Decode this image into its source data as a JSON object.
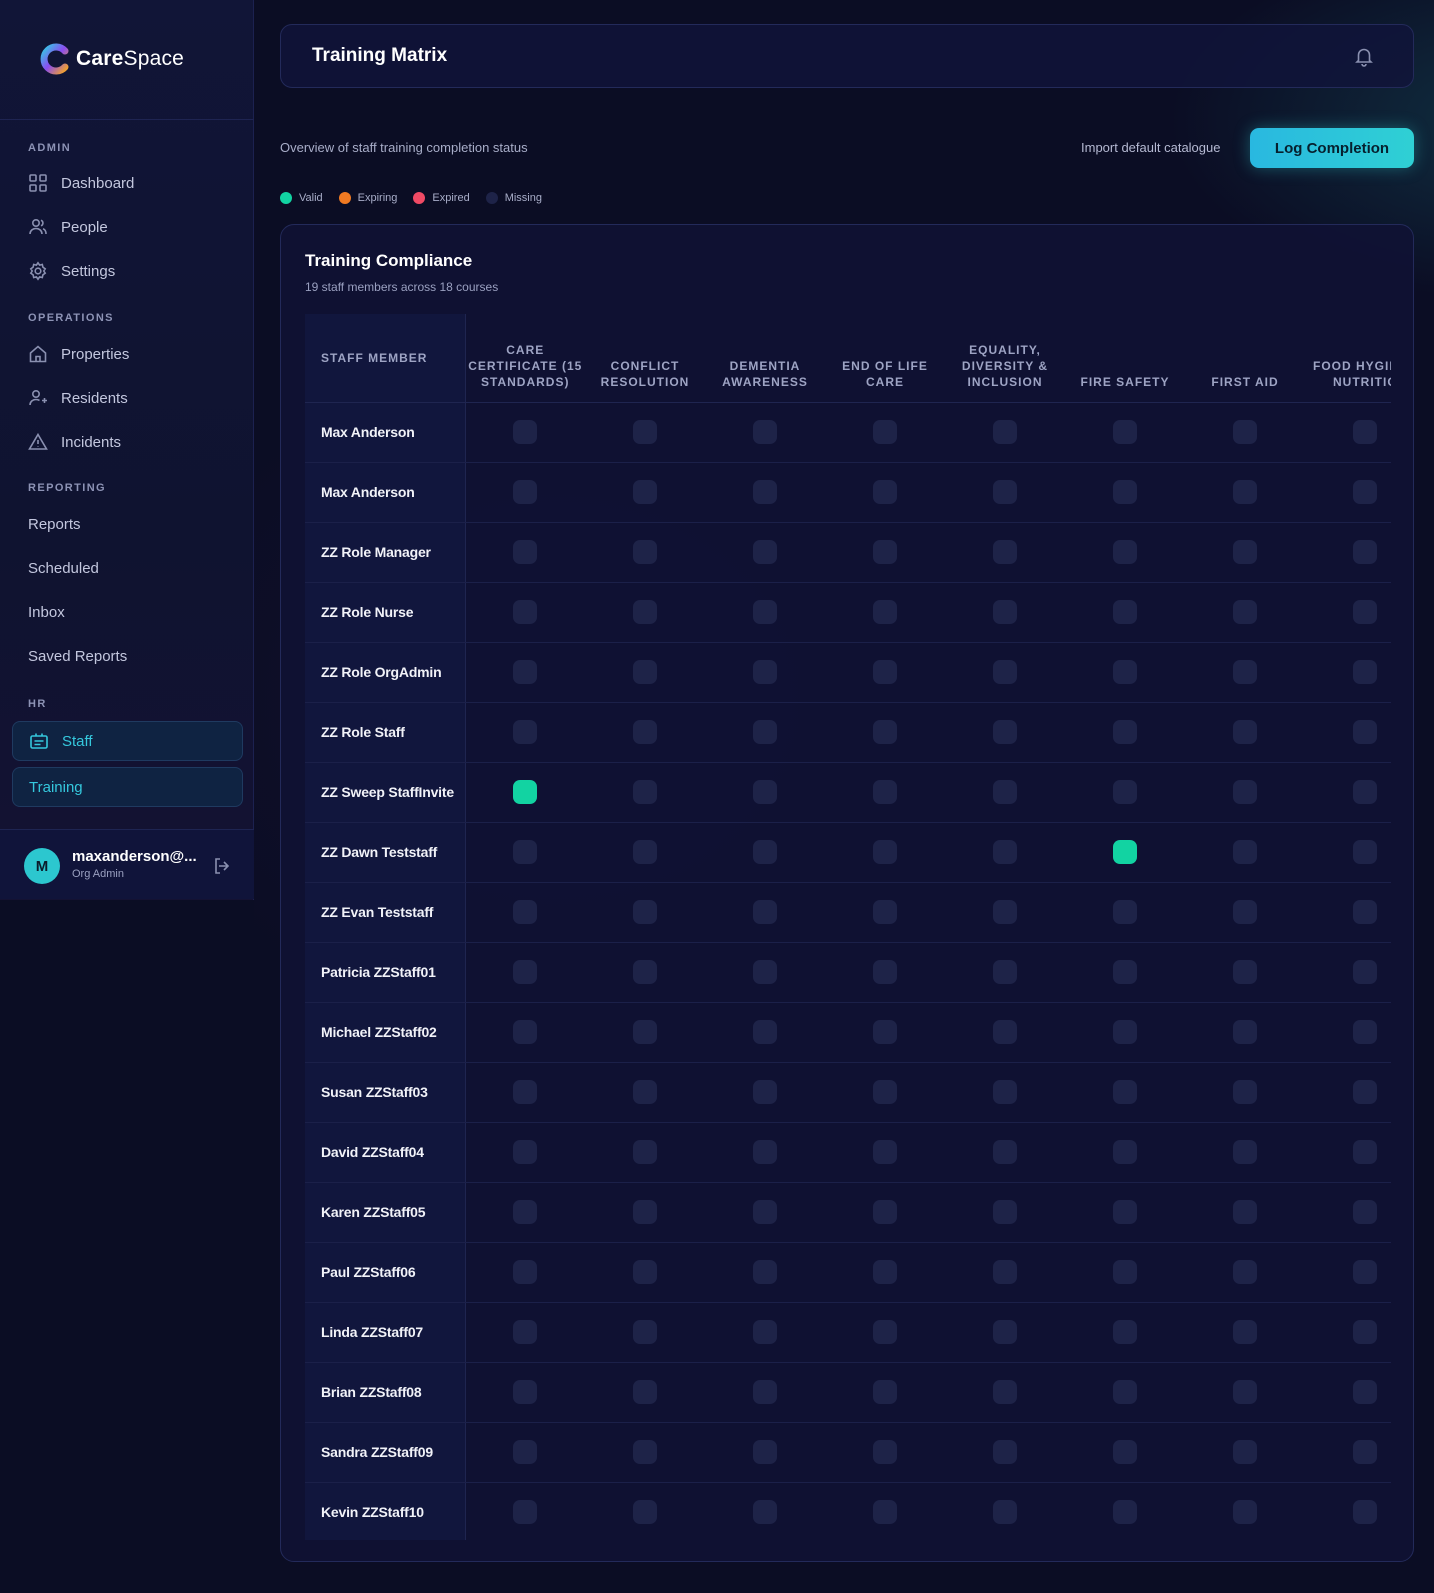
{
  "app": {
    "name_bold": "Care",
    "name_rest": "Space"
  },
  "sidebar": {
    "sections": {
      "admin": "ADMIN",
      "operations": "OPERATIONS",
      "reporting": "REPORTING",
      "hr": "HR"
    },
    "items": {
      "dashboard": "Dashboard",
      "people": "People",
      "settings": "Settings",
      "properties": "Properties",
      "residents": "Residents",
      "incidents": "Incidents",
      "reports": "Reports",
      "scheduled": "Scheduled",
      "inbox": "Inbox",
      "saved_reports": "Saved Reports",
      "staff": "Staff",
      "training": "Training"
    },
    "user": {
      "initial": "M",
      "name": "maxanderson@...",
      "role": "Org Admin"
    }
  },
  "header": {
    "title": "Training Matrix"
  },
  "toolbar": {
    "subtitle": "Overview of staff training completion status",
    "import_label": "Import default catalogue",
    "log_label": "Log Completion"
  },
  "legend": [
    {
      "label": "Valid",
      "color": "#12d3a2"
    },
    {
      "label": "Expiring",
      "color": "#f07a22"
    },
    {
      "label": "Expired",
      "color": "#f04a65"
    },
    {
      "label": "Missing",
      "color": "#1e2348"
    }
  ],
  "card": {
    "title": "Training Compliance",
    "subtitle": "19 staff members across 18 courses"
  },
  "table": {
    "staff_header": "STAFF MEMBER",
    "courses": [
      "CARE CERTIFICATE (15 STANDARDS)",
      "CONFLICT RESOLUTION",
      "DEMENTIA AWARENESS",
      "END OF LIFE CARE",
      "EQUALITY, DIVERSITY & INCLUSION",
      "FIRE SAFETY",
      "FIRST AID",
      "FOOD HYGIENE NUTRITIC"
    ],
    "rows": [
      {
        "name": "Max Anderson",
        "status": [
          "missing",
          "missing",
          "missing",
          "missing",
          "missing",
          "missing",
          "missing",
          "missing"
        ]
      },
      {
        "name": "Max Anderson",
        "status": [
          "missing",
          "missing",
          "missing",
          "missing",
          "missing",
          "missing",
          "missing",
          "missing"
        ]
      },
      {
        "name": "ZZ Role Manager",
        "status": [
          "missing",
          "missing",
          "missing",
          "missing",
          "missing",
          "missing",
          "missing",
          "missing"
        ]
      },
      {
        "name": "ZZ Role Nurse",
        "status": [
          "missing",
          "missing",
          "missing",
          "missing",
          "missing",
          "missing",
          "missing",
          "missing"
        ]
      },
      {
        "name": "ZZ Role OrgAdmin",
        "status": [
          "missing",
          "missing",
          "missing",
          "missing",
          "missing",
          "missing",
          "missing",
          "missing"
        ]
      },
      {
        "name": "ZZ Role Staff",
        "status": [
          "missing",
          "missing",
          "missing",
          "missing",
          "missing",
          "missing",
          "missing",
          "missing"
        ]
      },
      {
        "name": "ZZ Sweep StaffInvite",
        "status": [
          "valid",
          "missing",
          "missing",
          "missing",
          "missing",
          "missing",
          "missing",
          "missing"
        ]
      },
      {
        "name": "ZZ Dawn Teststaff",
        "status": [
          "missing",
          "missing",
          "missing",
          "missing",
          "missing",
          "valid",
          "missing",
          "missing"
        ]
      },
      {
        "name": "ZZ Evan Teststaff",
        "status": [
          "missing",
          "missing",
          "missing",
          "missing",
          "missing",
          "missing",
          "missing",
          "missing"
        ]
      },
      {
        "name": "Patricia ZZStaff01",
        "status": [
          "missing",
          "missing",
          "missing",
          "missing",
          "missing",
          "missing",
          "missing",
          "missing"
        ]
      },
      {
        "name": "Michael ZZStaff02",
        "status": [
          "missing",
          "missing",
          "missing",
          "missing",
          "missing",
          "missing",
          "missing",
          "missing"
        ]
      },
      {
        "name": "Susan ZZStaff03",
        "status": [
          "missing",
          "missing",
          "missing",
          "missing",
          "missing",
          "missing",
          "missing",
          "missing"
        ]
      },
      {
        "name": "David ZZStaff04",
        "status": [
          "missing",
          "missing",
          "missing",
          "missing",
          "missing",
          "missing",
          "missing",
          "missing"
        ]
      },
      {
        "name": "Karen ZZStaff05",
        "status": [
          "missing",
          "missing",
          "missing",
          "missing",
          "missing",
          "missing",
          "missing",
          "missing"
        ]
      },
      {
        "name": "Paul ZZStaff06",
        "status": [
          "missing",
          "missing",
          "missing",
          "missing",
          "missing",
          "missing",
          "missing",
          "missing"
        ]
      },
      {
        "name": "Linda ZZStaff07",
        "status": [
          "missing",
          "missing",
          "missing",
          "missing",
          "missing",
          "missing",
          "missing",
          "missing"
        ]
      },
      {
        "name": "Brian ZZStaff08",
        "status": [
          "missing",
          "missing",
          "missing",
          "missing",
          "missing",
          "missing",
          "missing",
          "missing"
        ]
      },
      {
        "name": "Sandra ZZStaff09",
        "status": [
          "missing",
          "missing",
          "missing",
          "missing",
          "missing",
          "missing",
          "missing",
          "missing"
        ]
      },
      {
        "name": "Kevin ZZStaff10",
        "status": [
          "missing",
          "missing",
          "missing",
          "missing",
          "missing",
          "missing",
          "missing",
          "missing"
        ]
      }
    ]
  }
}
